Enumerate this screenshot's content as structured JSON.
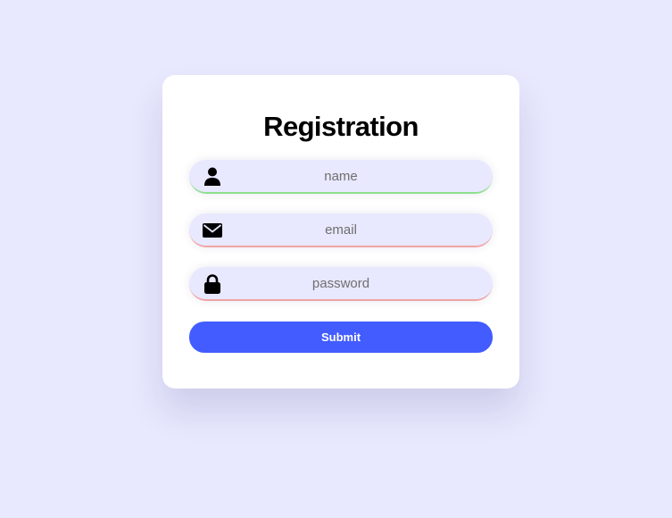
{
  "page": {
    "background_color": "#e8e8fe"
  },
  "form": {
    "title": "Registration",
    "fields": [
      {
        "name": "name",
        "placeholder": "name",
        "icon": "user-icon",
        "input_type": "text",
        "validation_state": "valid",
        "border_color": "#8ee08e"
      },
      {
        "name": "email",
        "placeholder": "email",
        "icon": "envelope-icon",
        "input_type": "email",
        "validation_state": "invalid",
        "border_color": "#f0a4a4"
      },
      {
        "name": "password",
        "placeholder": "password",
        "icon": "lock-icon",
        "input_type": "password",
        "validation_state": "invalid",
        "border_color": "#f0a4a4"
      }
    ],
    "submit_label": "Submit",
    "submit_color": "#425cff"
  }
}
